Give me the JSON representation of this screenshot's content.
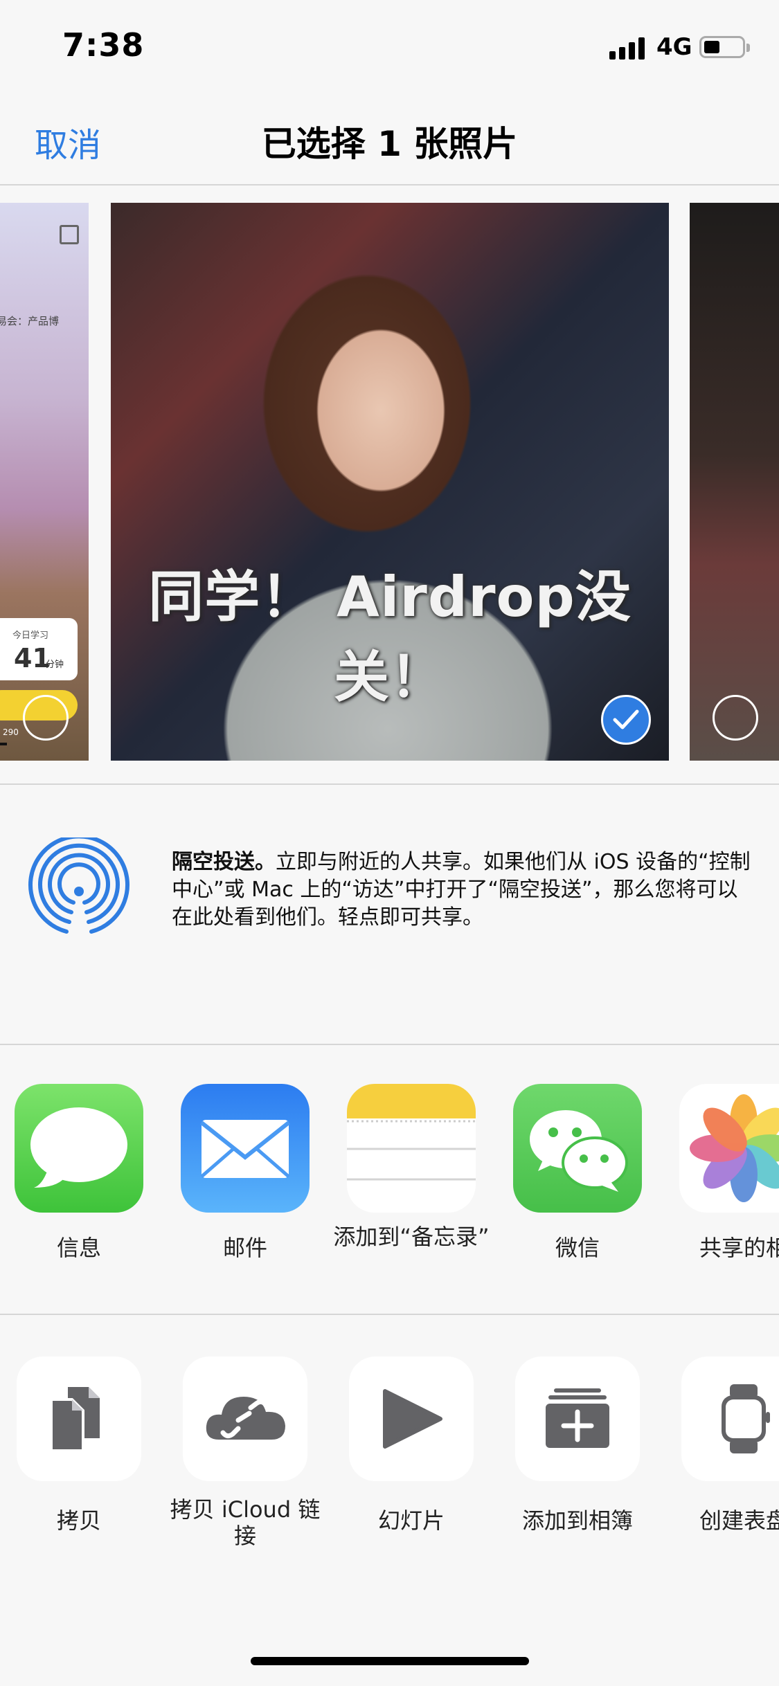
{
  "status_bar": {
    "time": "7:38",
    "network": "4G"
  },
  "nav": {
    "cancel": "取消",
    "title": "已选择 1 张照片"
  },
  "photos": {
    "left": {
      "caption": "友易会：产品博",
      "card_label": "今日学习",
      "card_value": "41",
      "card_unit": "分钟",
      "small_text": "290"
    },
    "main": {
      "meme_text": "同学！ Airdrop没关！"
    }
  },
  "airdrop": {
    "title": "隔空投送。",
    "description": "立即与附近的人共享。如果他们从 iOS 设备的“控制中心”或 Mac 上的“访达”中打开了“隔空投送”，那么您将可以在此处看到他们。轻点即可共享。"
  },
  "share_apps": [
    {
      "label": "信息",
      "icon": "messages-icon"
    },
    {
      "label": "邮件",
      "icon": "mail-icon"
    },
    {
      "label": "添加到“备忘录”",
      "icon": "notes-icon"
    },
    {
      "label": "微信",
      "icon": "wechat-icon"
    },
    {
      "label": "共享的相",
      "icon": "photos-icon"
    }
  ],
  "actions": [
    {
      "label": "拷贝",
      "icon": "copy-icon"
    },
    {
      "label": "拷贝 iCloud 链接",
      "icon": "icloud-link-icon"
    },
    {
      "label": "幻灯片",
      "icon": "play-icon"
    },
    {
      "label": "添加到相簿",
      "icon": "add-album-icon"
    },
    {
      "label": "创建表盘",
      "icon": "watch-icon"
    }
  ],
  "colors": {
    "accent": "#2f7de1",
    "background": "#f7f7f7"
  }
}
